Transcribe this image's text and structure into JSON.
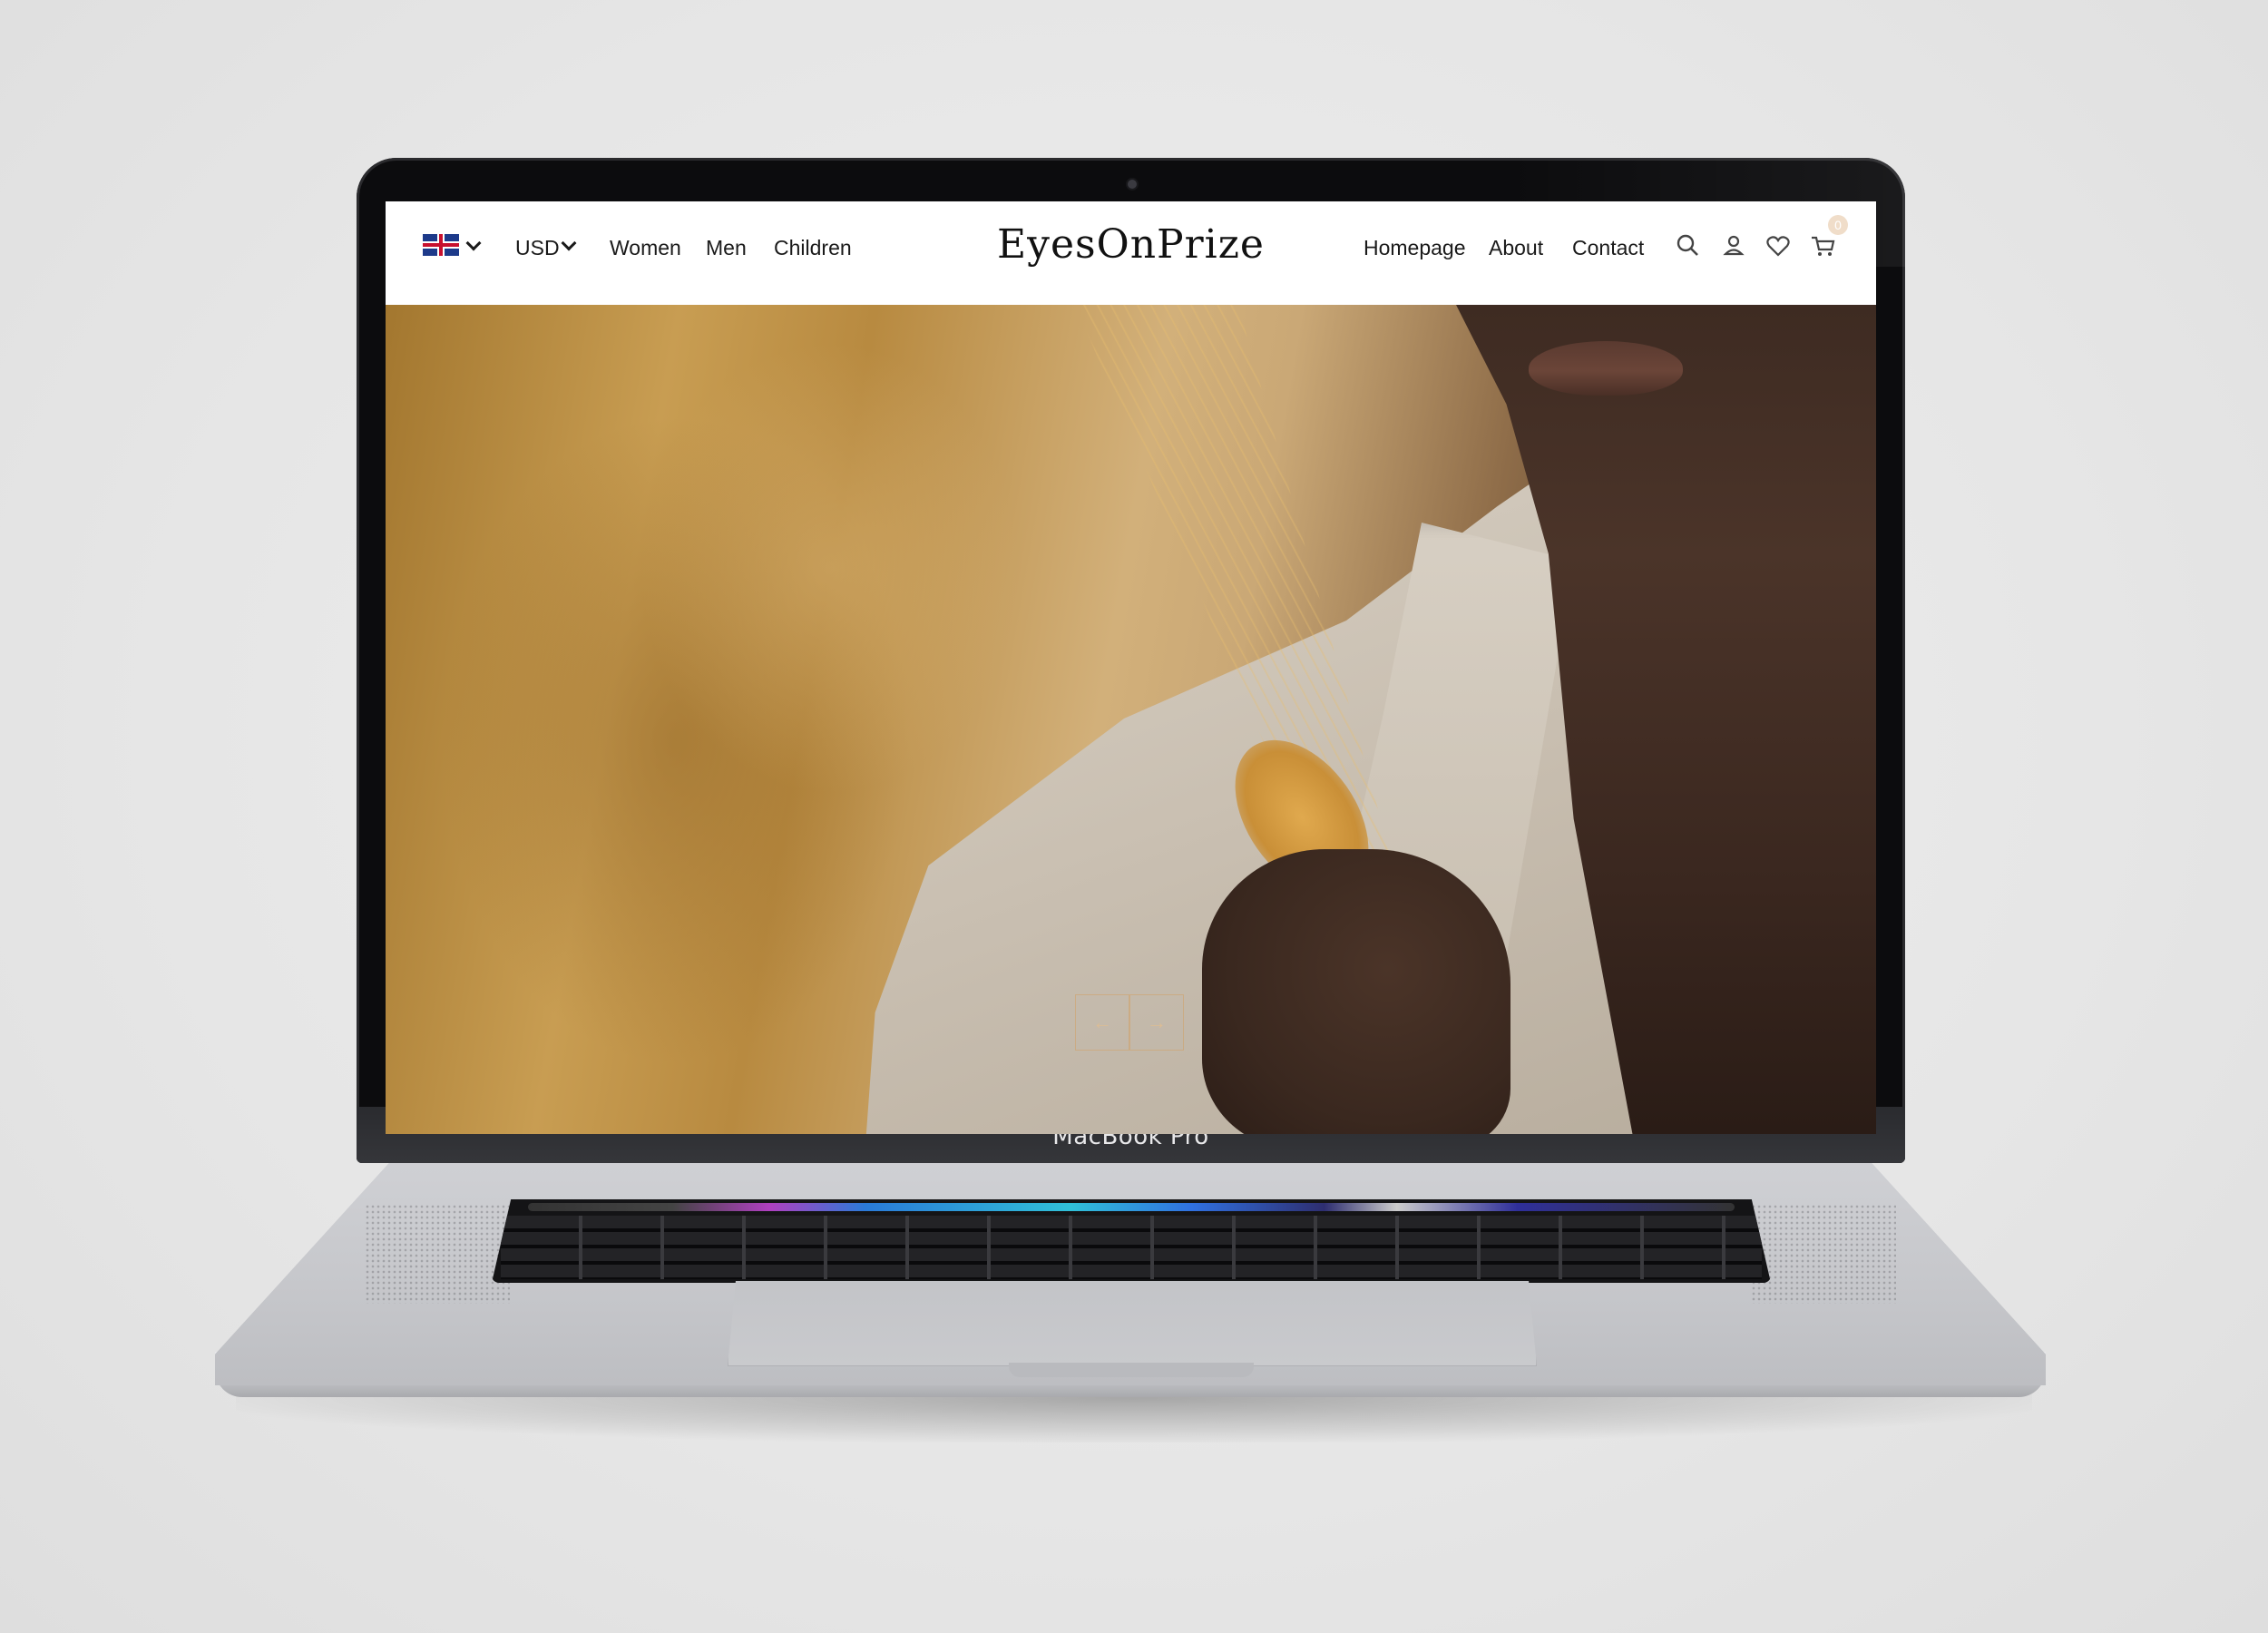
{
  "device": {
    "brand_label": "MacBook Pro"
  },
  "site": {
    "logo": "EyesOnPrize",
    "language": {
      "icon": "uk-flag-icon"
    },
    "currency": "USD",
    "nav_left": [
      "Women",
      "Men",
      "Children"
    ],
    "nav_right": [
      "Homepage",
      "About",
      "Contact"
    ],
    "cart_count": "0",
    "icons": [
      "search-icon",
      "user-icon",
      "heart-icon",
      "cart-icon"
    ]
  },
  "hero": {
    "prev_label": "←",
    "next_label": "→"
  },
  "colors": {
    "accent": "#f0ddc9",
    "text": "#1a1a1a"
  }
}
